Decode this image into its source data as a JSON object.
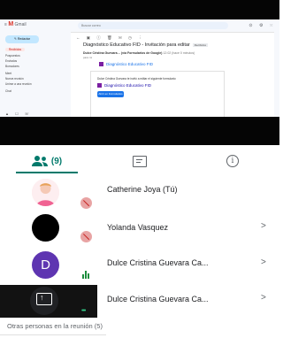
{
  "shared_screen": {
    "app_name": "Gmail",
    "search_placeholder": "Buscar correo",
    "compose_label": "Redactar",
    "sidebar_items": [
      "Recibidos",
      "Pospuestos",
      "Enviados",
      "Borradores",
      "Meet",
      "Nueva reunión",
      "Unirse a una reunión",
      "Chat"
    ],
    "email_subject": "Diagnóstico Educativo FID - Invitación para editar",
    "email_tag": "Recibidos",
    "sender_name": "Dulce Cristina Guevara… (vía Formularios de Google)",
    "sender_time": "12:02 (hace 0 minutos)",
    "recipient": "para mí",
    "form_title": "Diagnóstico Educativo FID",
    "card_text": "Dulce Cristina Guevara te invitó a editar el siguiente formulario:",
    "card_link": "Diagnóstico Educativo FID",
    "open_button": "Abrir en Formularios"
  },
  "tabs": {
    "people_count": "(9)"
  },
  "participants": [
    {
      "name": "Catherine Joya (Tú)",
      "avatar": "photo",
      "status": "muted",
      "chevron": ""
    },
    {
      "name": "Yolanda Vasquez",
      "avatar": "black",
      "status": "muted",
      "chevron": ">"
    },
    {
      "name": "Dulce Cristina Guevara Ca...",
      "avatar": "D",
      "avatar_color": "#5e35b1",
      "status": "speaking",
      "chevron": ">"
    },
    {
      "name": "Dulce Cristina Guevara Ca...",
      "avatar": "presentation",
      "status": "presenting",
      "chevron": ">"
    }
  ],
  "others_label": "Otras personas en la reunión (5)",
  "colors": {
    "accent": "#00796b",
    "muted_mic": "#c5221f",
    "speaking": "#1e8e3e",
    "avatar_d": "#5e35b1"
  }
}
